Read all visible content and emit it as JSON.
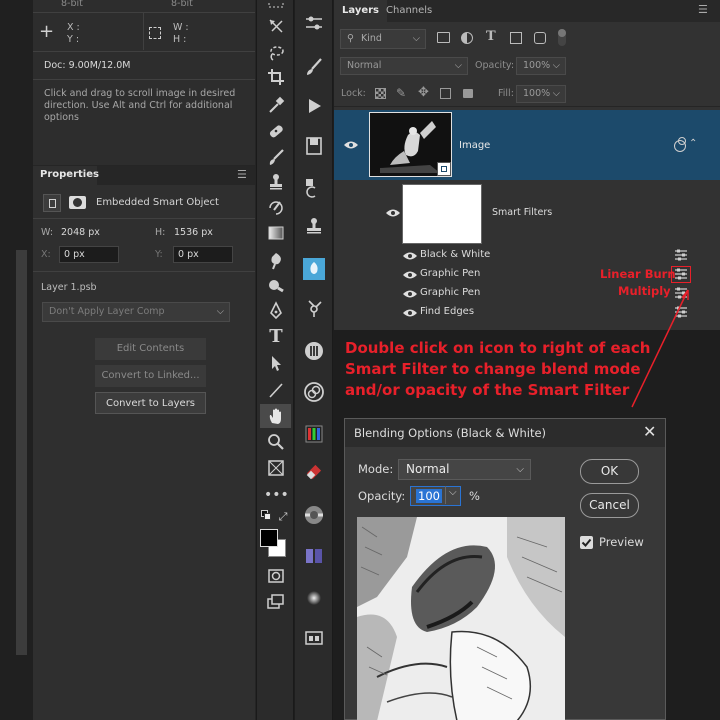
{
  "info": {
    "bit1": "8-bit",
    "bit2": "8-bit",
    "x_label": "X :",
    "y_label": "Y :",
    "w_label": "W :",
    "h_label": "H :",
    "doc": "Doc: 9.00M/12.0M",
    "hint": "Click and drag to scroll image in desired direction.  Use Alt and Ctrl for additional options"
  },
  "properties": {
    "title": "Properties",
    "type": "Embedded Smart Object",
    "w_label": "W:",
    "w_value": "2048 px",
    "h_label": "H:",
    "h_value": "1536 px",
    "x_label": "X:",
    "x_value": "0 px",
    "y_label": "Y:",
    "y_value": "0 px",
    "filename": "Layer 1.psb",
    "layer_comp": "Don't Apply Layer Comp",
    "btn_edit": "Edit Contents",
    "btn_linked": "Convert to Linked...",
    "btn_layers": "Convert to Layers"
  },
  "layers_panel": {
    "tab_layers": "Layers",
    "tab_channels": "Channels",
    "kind": "Kind",
    "blend": "Normal",
    "opacity_label": "Opacity:",
    "opacity_value": "100%",
    "lock_label": "Lock:",
    "fill_label": "Fill:",
    "fill_value": "100%",
    "layer_name": "Image",
    "smart_filters": "Smart Filters",
    "filters": [
      "Black & White",
      "Graphic Pen",
      "Graphic Pen",
      "Find Edges"
    ]
  },
  "annotations": {
    "linear_burn": "Linear Burn",
    "multiply": "Multiply",
    "instruction": "Double click on icon to right of each Smart Filter to change blend mode and/or opacity of the Smart Filter",
    "instruction_lines": [
      "Double click on icon to right of each",
      "Smart Filter to change blend mode",
      "and/or opacity of the Smart Filter"
    ],
    "color": "#e8202a"
  },
  "dialog": {
    "title": "Blending Options (Black & White)",
    "mode_label": "Mode:",
    "mode_value": "Normal",
    "opacity_label": "Opacity:",
    "opacity_value": "100",
    "percent": "%",
    "ok": "OK",
    "cancel": "Cancel",
    "preview_label": "Preview",
    "preview_checked": true
  },
  "colors": {
    "selected_layer": "#1c4a6b",
    "accent": "#2a74d4"
  }
}
